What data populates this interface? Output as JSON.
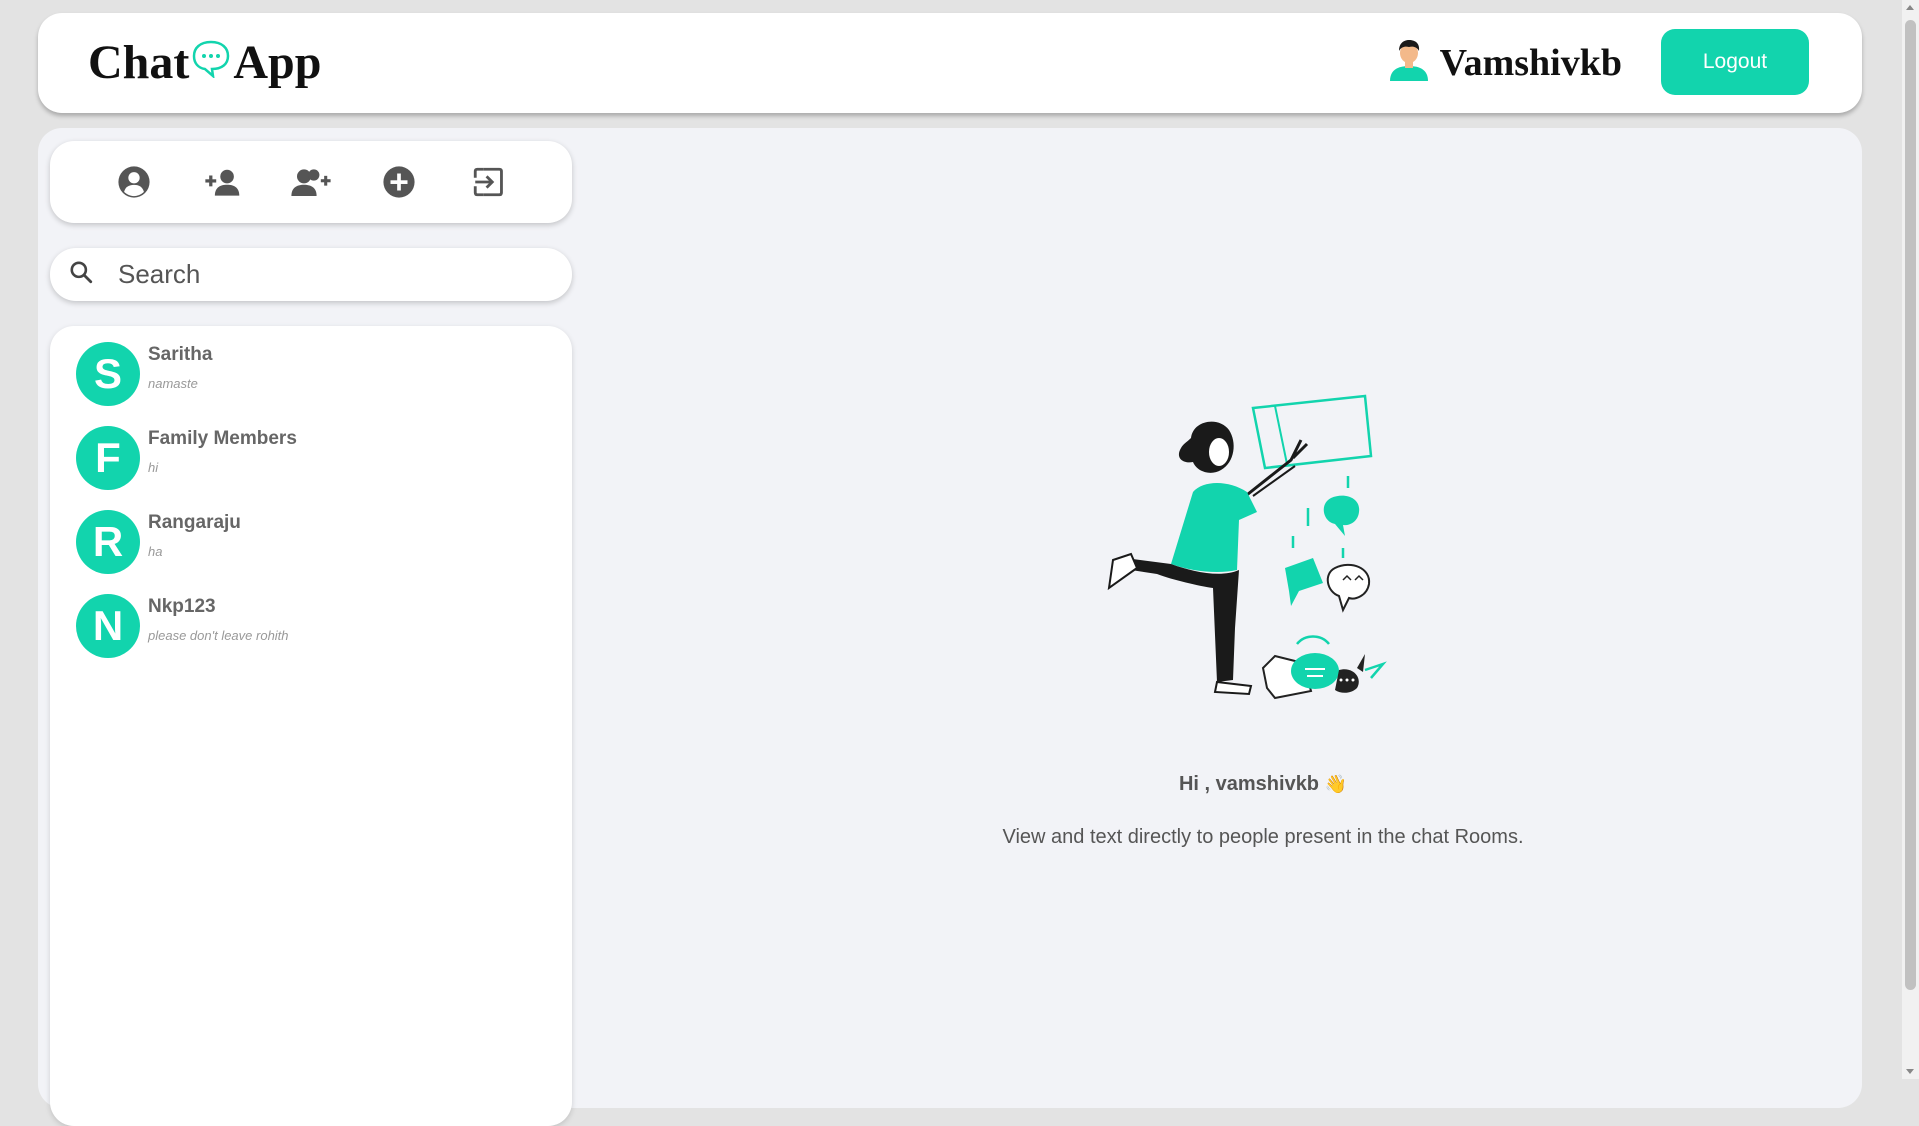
{
  "header": {
    "logo_left": "Chat",
    "logo_right": "App",
    "username": "Vamshivkb",
    "logout_label": "Logout"
  },
  "toolbar": {
    "icons": [
      "profile-icon",
      "add-user-icon",
      "add-group-icon",
      "create-room-icon",
      "exit-icon"
    ]
  },
  "search": {
    "placeholder": "Search",
    "value": ""
  },
  "chats": [
    {
      "initial": "S",
      "name": "Saritha",
      "last": "namaste"
    },
    {
      "initial": "F",
      "name": "Family Members",
      "last": "hi"
    },
    {
      "initial": "R",
      "name": "Rangaraju",
      "last": "ha"
    },
    {
      "initial": "N",
      "name": "Nkp123",
      "last": "please don't leave rohith"
    }
  ],
  "welcome": {
    "greeting": "Hi , vamshivkb",
    "wave": "👋",
    "description": "View and text directly to people present in the chat Rooms."
  },
  "colors": {
    "accent": "#12d4ad",
    "panel": "#f2f3f7",
    "page": "#e3e3e3"
  }
}
